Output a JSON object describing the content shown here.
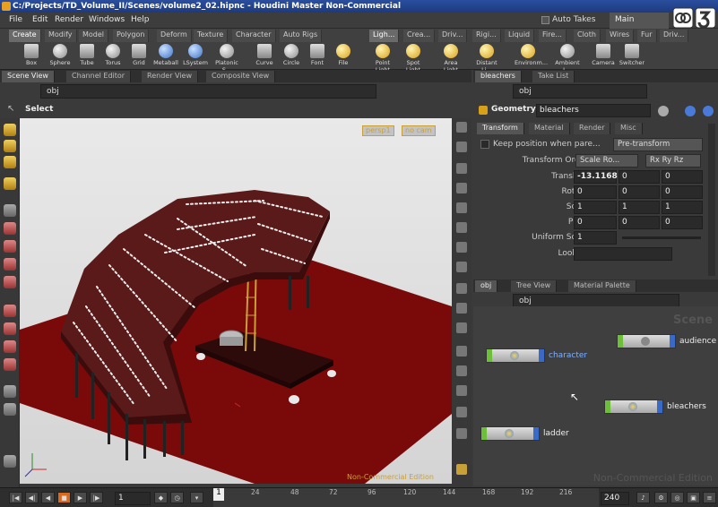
{
  "window": {
    "title": "C:/Projects/TD_Volume_II/Scenes/volume2_02.hipnc - Houdini Master Non-Commercial"
  },
  "menubar": {
    "items": [
      "File",
      "Edit",
      "Render",
      "Windows",
      "Help"
    ],
    "auto_takes": "Auto Takes",
    "main_tab": "Main"
  },
  "shelf": {
    "tabs_left": [
      "Create",
      "Modify",
      "Model",
      "Polygon",
      "Deform",
      "Texture",
      "Character",
      "Auto Rigs"
    ],
    "tabs_right": [
      "Ligh...",
      "Crea...",
      "Driv...",
      "Rigi...",
      "Liquid",
      "Fire...",
      "Cloth",
      "Wires",
      "Fur",
      "Driv..."
    ],
    "tools_left": [
      "Box",
      "Sphere",
      "Tube",
      "Torus",
      "Grid",
      "Metaball",
      "LSystem",
      "Platonic S...",
      "Curve",
      "Circle",
      "Font",
      "File"
    ],
    "tools_right": [
      "Point Light",
      "Spot Light",
      "Area Light",
      "Distant Li...",
      "Environm...",
      "Ambient L...",
      "Camera",
      "Switcher"
    ]
  },
  "left_pane": {
    "tabs": [
      "Scene View",
      "Channel Editor",
      "Render View",
      "Composite View"
    ],
    "path": "obj",
    "select_label": "Select",
    "camera_dropdown": "persp1",
    "cam_dropdown2": "no cam",
    "watermark": "Non-Commercial Edition"
  },
  "param_pane": {
    "tabs_top": [
      "bleachers",
      "Take List"
    ],
    "path": "obj",
    "node_type": "Geometry",
    "node_name": "bleachers",
    "tabs": [
      "Transform",
      "Material",
      "Render",
      "Misc"
    ],
    "keep_position": "Keep position when pare...",
    "pre_transform": "Pre-transform",
    "rows": [
      {
        "label": "Transform Order",
        "v1": "Scale Ro...",
        "v2": "Rx Ry Rz"
      },
      {
        "label": "Translate",
        "v1": "-13.1168",
        "v2": "0",
        "v3": "0"
      },
      {
        "label": "Rotate",
        "v1": "0",
        "v2": "0",
        "v3": "0"
      },
      {
        "label": "Scale",
        "v1": "1",
        "v2": "1",
        "v3": "1"
      },
      {
        "label": "Pivot",
        "v1": "0",
        "v2": "0",
        "v3": "0"
      },
      {
        "label": "Uniform Scale",
        "v1": "1"
      },
      {
        "label": "Look At",
        "v1": ""
      }
    ]
  },
  "network_pane": {
    "tabs": [
      "obj",
      "Tree View",
      "Material Palette"
    ],
    "path": "obj",
    "watermark_scene": "Scene",
    "watermark": "Non-Commercial Edition",
    "nodes": [
      "character",
      "audience",
      "bleachers",
      "ladder"
    ]
  },
  "timeline": {
    "frame": "1",
    "start": "1",
    "end": "240",
    "ticks": [
      "24",
      "48",
      "72",
      "96",
      "120",
      "144",
      "168",
      "192",
      "216"
    ]
  },
  "colors": {
    "accent": "#c8a038",
    "floor": "#7a0a0a",
    "bleacher": "#5a1a1a",
    "node_green": "#6dbf3a",
    "node_blue": "#3a6ac8"
  }
}
